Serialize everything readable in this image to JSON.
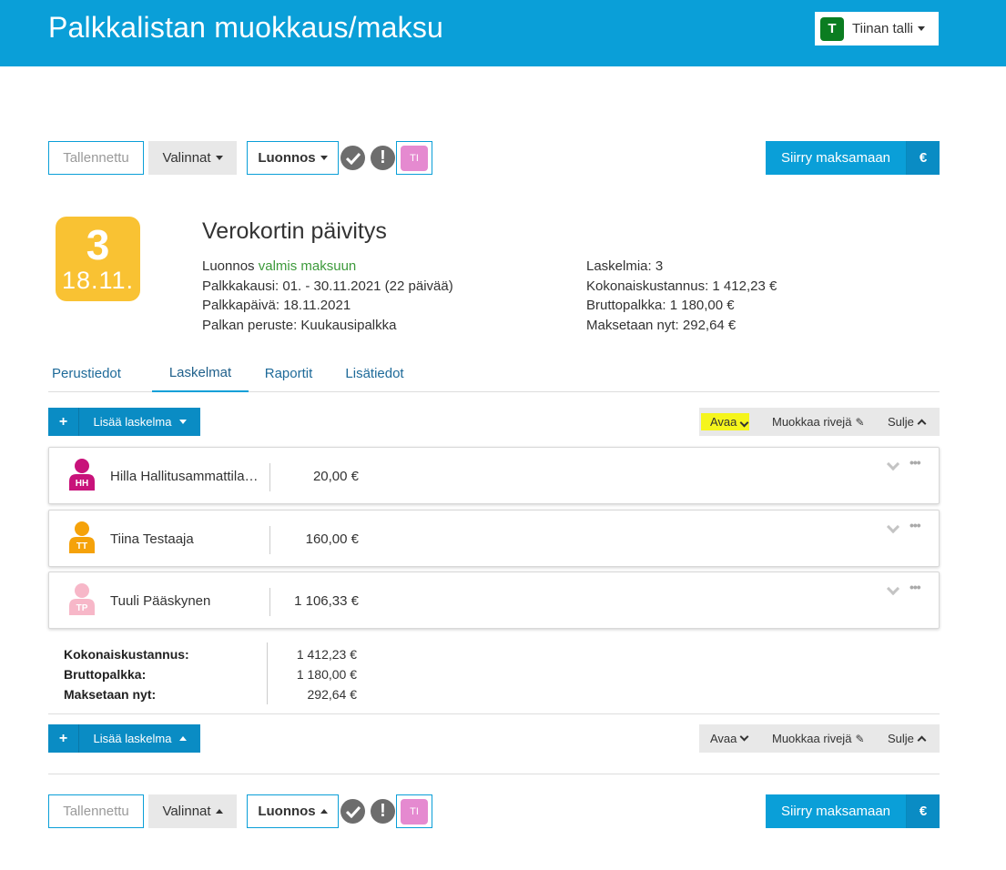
{
  "header": {
    "title": "Palkkalistan muokkaus/maksu",
    "stable_initial": "T",
    "stable_name": "Tiinan talli"
  },
  "toolbar": {
    "saved_label": "Tallennettu",
    "options_label": "Valinnat",
    "draft_label": "Luonnos",
    "avatar_initials": "TI",
    "pay_label": "Siirry maksamaan",
    "euro_symbol": "€"
  },
  "run": {
    "count": "3",
    "date_short": "18.11.",
    "title": "Verokortin päivitys",
    "status_prefix": "Luonnos",
    "status_ready": "valmis maksuun",
    "period": "Palkkakausi: 01. - 30.11.2021 (22 päivää)",
    "pay_date": "Palkkapäivä: 18.11.2021",
    "basis": "Palkan peruste: Kuukausipalkka",
    "calc_count": "Laskelmia: 3",
    "total_cost": "Kokonaiskustannus: 1 412,23 €",
    "gross": "Bruttopalkka: 1 180,00 €",
    "pay_now": "Maksetaan nyt: 292,64 €"
  },
  "tabs": [
    {
      "label": "Perustiedot"
    },
    {
      "label": "Laskelmat"
    },
    {
      "label": "Raportit"
    },
    {
      "label": "Lisätiedot"
    }
  ],
  "actions": {
    "add_label": "Lisää laskelma",
    "open_label": "Avaa",
    "edit_rows_label": "Muokkaa rivejä",
    "close_label": "Sulje"
  },
  "calculations": [
    {
      "initials": "HH",
      "name": "Hilla Hallitusammattilainen",
      "amount": "20,00 €",
      "color": "#c8127a"
    },
    {
      "initials": "TT",
      "name": "Tiina Testaaja",
      "amount": "160,00 €",
      "color": "#f5a20a"
    },
    {
      "initials": "TP",
      "name": "Tuuli Pääskynen",
      "amount": "1 106,33 €",
      "color": "#f7b7c8"
    }
  ],
  "totals": {
    "cost_label": "Kokonaiskustannus:",
    "cost_value": "1 412,23 €",
    "gross_label": "Bruttopalkka:",
    "gross_value": "1 180,00 €",
    "pay_label": "Maksetaan nyt:",
    "pay_value": "292,64 €"
  },
  "colors": {
    "brand": "#0a9fd8",
    "badge": "#f9c233",
    "ready": "#3d9a3b",
    "highlight": "#f5f51c"
  }
}
